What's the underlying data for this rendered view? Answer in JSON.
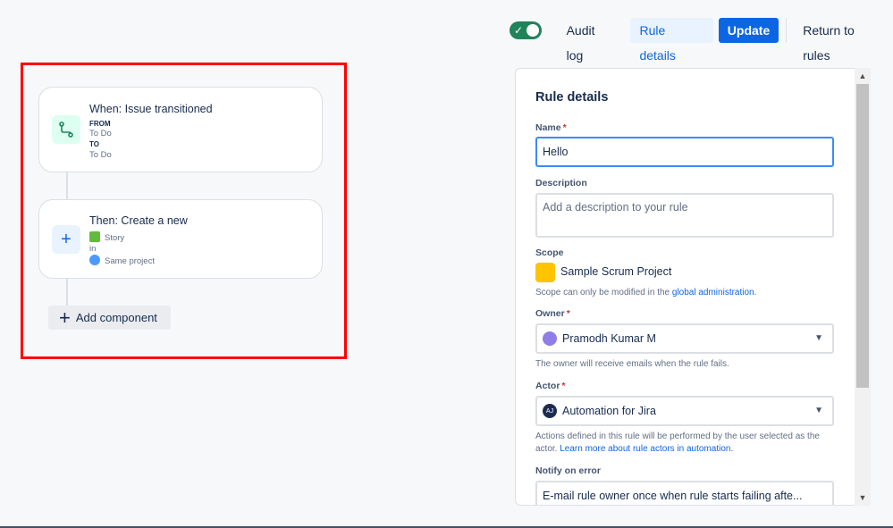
{
  "toolbar": {
    "toggle_enabled": true,
    "audit_log": "Audit log",
    "rule_details": "Rule details",
    "update": "Update",
    "return": "Return to rules"
  },
  "flow": {
    "trigger": {
      "title": "When: Issue transitioned",
      "from_label": "FROM",
      "from_value": "To Do",
      "to_label": "TO",
      "to_value": "To Do",
      "icon": "transition-icon"
    },
    "action": {
      "title": "Then: Create a new",
      "issue_type": "Story",
      "in_label": "in",
      "project": "Same project",
      "icon": "plus-icon"
    },
    "add_component": "Add component"
  },
  "panel": {
    "title": "Rule details",
    "name_label": "Name",
    "name_value": "Hello",
    "description_label": "Description",
    "description_placeholder": "Add a description to your rule",
    "scope_label": "Scope",
    "scope_value": "Sample Scrum Project",
    "scope_help": "Scope can only be modified in the ",
    "scope_help_link": "global administration",
    "scope_help_end": ".",
    "owner_label": "Owner",
    "owner_value": "Pramodh Kumar M",
    "owner_help": "The owner will receive emails when the rule fails.",
    "actor_label": "Actor",
    "actor_value": "Automation for Jira",
    "actor_avatar": "AJ",
    "actor_help": "Actions defined in this rule will be performed by the user selected as the actor. ",
    "actor_help_link": "Learn more about rule actors in automation.",
    "notify_label": "Notify on error",
    "notify_value": "E-mail rule owner once when rule starts failing afte..."
  },
  "colors": {
    "accent": "#0c66e4",
    "toggle_on": "#1f845a",
    "highlight": "#ff0000"
  }
}
